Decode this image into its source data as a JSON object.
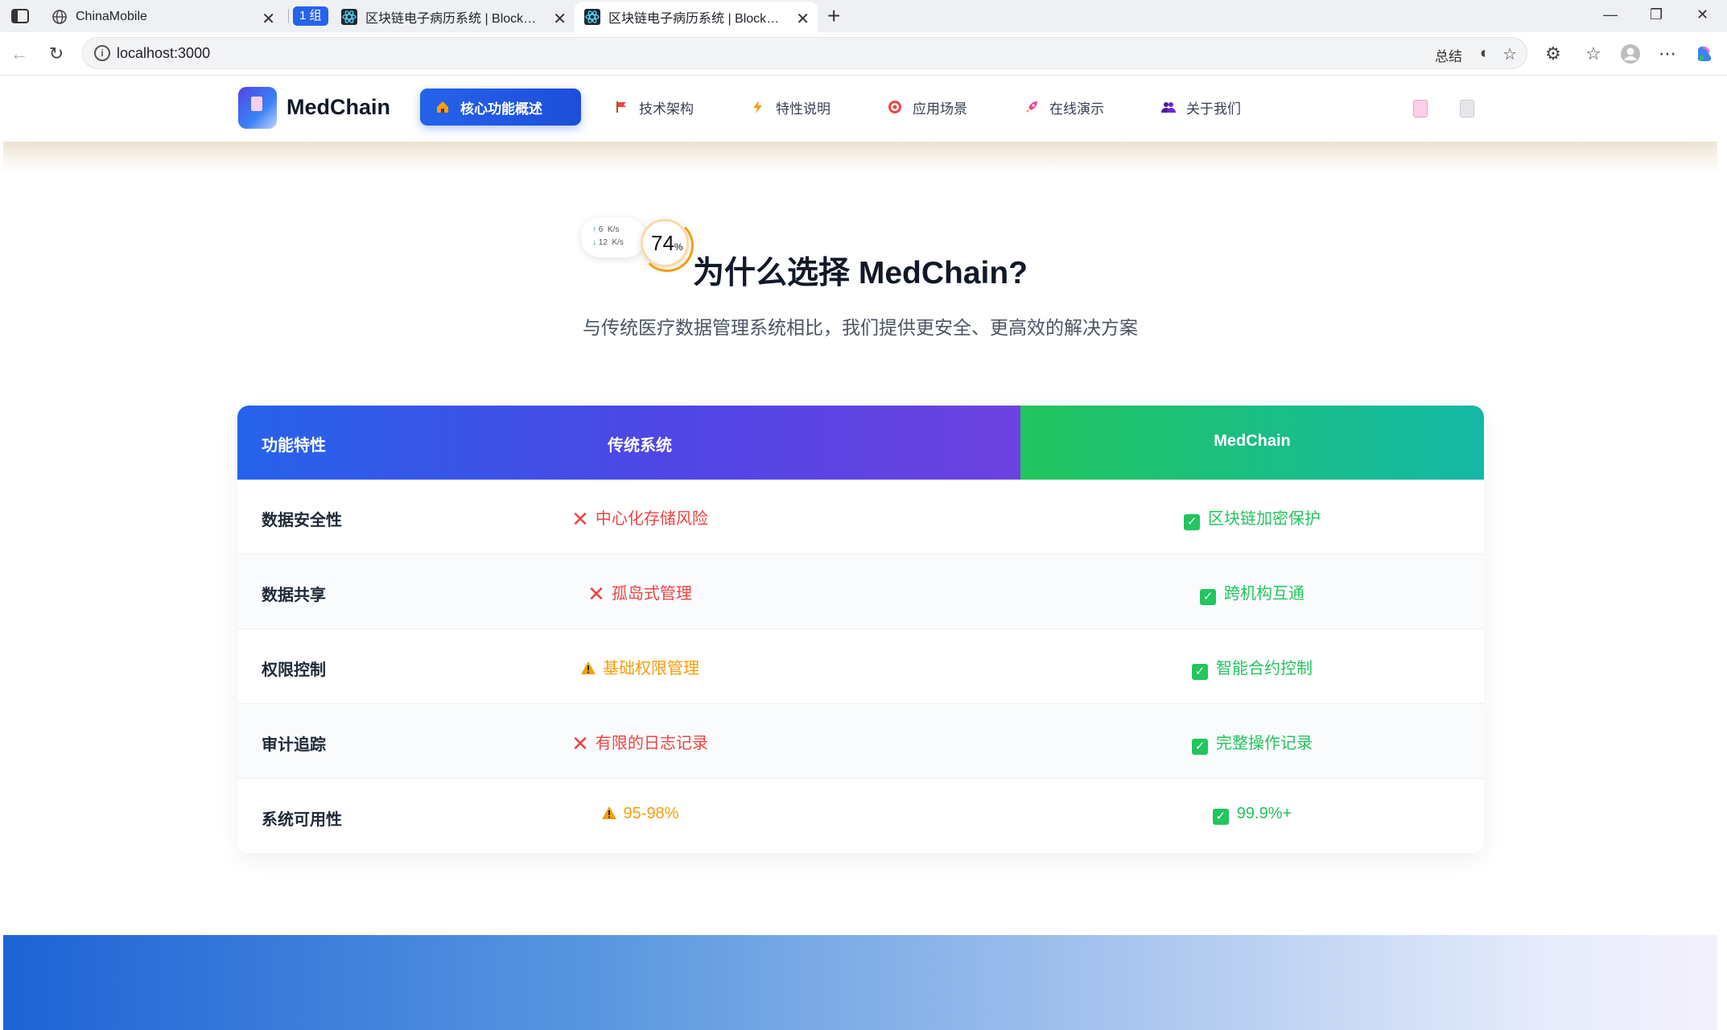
{
  "browser": {
    "tabs": [
      {
        "title": "ChinaMobile"
      },
      {
        "title": "区块链电子病历系统 | Blockchain"
      },
      {
        "title": "区块链电子病历系统 | Blockchain"
      }
    ],
    "group_label": "1 组",
    "url": "localhost:3000",
    "summary_label": "总结"
  },
  "navbar": {
    "brand": "MedChain",
    "items": [
      {
        "label": "核心功能概述",
        "icon": "house-icon"
      },
      {
        "label": "技术架构",
        "icon": "flag-icon"
      },
      {
        "label": "特性说明",
        "icon": "lightning-icon"
      },
      {
        "label": "应用场景",
        "icon": "target-icon"
      },
      {
        "label": "在线演示",
        "icon": "rocket-icon"
      },
      {
        "label": "关于我们",
        "icon": "people-icon"
      }
    ],
    "active_index": 0
  },
  "speed_widget": {
    "up": "6",
    "down": "12",
    "unit": "K/s",
    "percent": "74",
    "percent_sign": "%"
  },
  "section": {
    "title": "为什么选择 MedChain?",
    "subtitle": "与传统医疗数据管理系统相比，我们提供更安全、更高效的解决方案"
  },
  "comparison": {
    "headers": {
      "feature": "功能特性",
      "traditional": "传统系统",
      "medchain": "MedChain"
    },
    "rows": [
      {
        "feature": "数据安全性",
        "traditional": "中心化存储风险",
        "traditional_status": "bad",
        "medchain": "区块链加密保护"
      },
      {
        "feature": "数据共享",
        "traditional": "孤岛式管理",
        "traditional_status": "bad",
        "medchain": "跨机构互通"
      },
      {
        "feature": "权限控制",
        "traditional": "基础权限管理",
        "traditional_status": "warn",
        "medchain": "智能合约控制"
      },
      {
        "feature": "审计追踪",
        "traditional": "有限的日志记录",
        "traditional_status": "bad",
        "medchain": "完整操作记录"
      },
      {
        "feature": "系统可用性",
        "traditional": "95-98%",
        "traditional_status": "warn",
        "medchain": "99.9%+"
      }
    ]
  },
  "colors": {
    "primary": "#2563eb",
    "purple": "#6d42e0",
    "green": "#22c55e",
    "teal": "#14b8a6",
    "bad": "#ef4444",
    "warn": "#f59e0b"
  }
}
